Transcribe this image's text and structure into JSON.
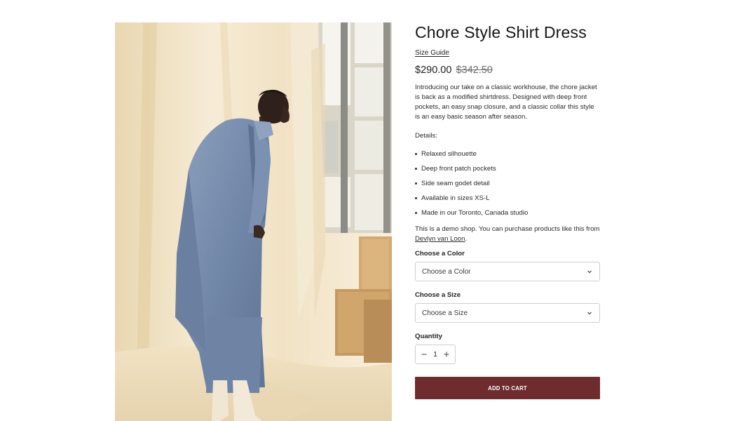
{
  "product": {
    "title": "Chore Style Shirt Dress",
    "image_alt": "Model wearing a long blue corduroy coat dress standing before draped cream fabric",
    "size_guide_label": "Size Guide",
    "price": "$290.00",
    "compare_price": "$342.50",
    "description": "Introducing our take on a classic workhouse, the chore jacket is back as a modified shirtdress. Designed with deep front pockets, an easy snap closure, and a classic collar this style is an easy basic season after season.",
    "details_label": "Details:",
    "details": [
      "Relaxed silhouette",
      "Deep front patch pockets",
      "Side seam godet detail",
      "Available in sizes XS-L",
      "Made in our Toronto, Canada studio"
    ],
    "demo_text": "This is a demo shop. You can purchase products like this from",
    "demo_link": "Devlyn van Loon",
    "demo_end": "."
  },
  "options": {
    "color_label": "Choose a Color",
    "color_value": "Choose a Color",
    "size_label": "Choose a Size",
    "size_value": "Choose a Size"
  },
  "quantity": {
    "label": "Quantity",
    "value": "1"
  },
  "cart": {
    "add_label": "ADD TO CART"
  },
  "colors": {
    "cart_button": "#6e2c2e",
    "backdrop": "#efe3c9",
    "coat": "#7d93b4"
  },
  "icons": {
    "select_chevron": "chevron-down-icon",
    "minus": "minus-icon",
    "plus": "plus-icon"
  }
}
